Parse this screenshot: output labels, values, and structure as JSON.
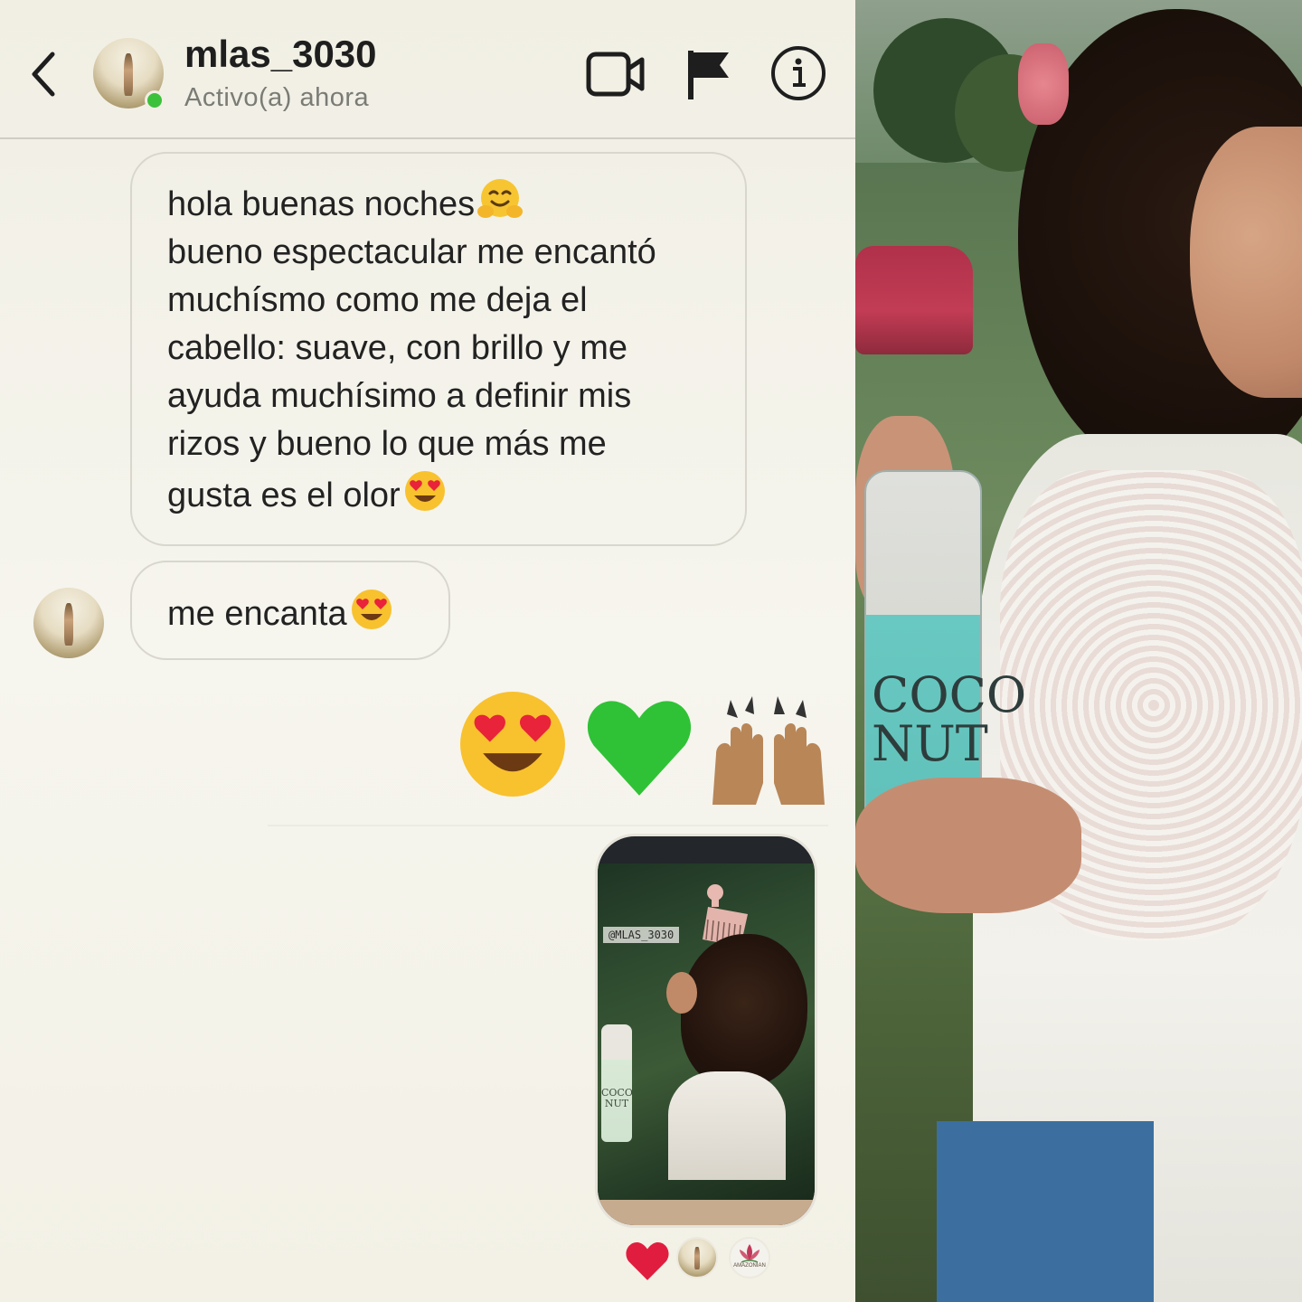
{
  "header": {
    "username": "mlas_3030",
    "status": "Activo(a) ahora",
    "icons": [
      "back-chevron-icon",
      "video-call-icon",
      "flag-icon",
      "info-icon"
    ]
  },
  "messages": [
    {
      "lines": [
        "hola buenas noches",
        "bueno espectacular me encantó",
        "muchísmo como me deja el",
        "cabello: suave, con brillo y me",
        "ayuda muchísimo a definir mis",
        "rizos y bueno lo que más me",
        "gusta es el olor"
      ],
      "emojis": [
        "hugging-face",
        "heart-eyes"
      ]
    },
    {
      "text": "me encanta",
      "emoji": "heart-eyes"
    }
  ],
  "sent_emojis": [
    "heart-eyes",
    "green-heart",
    "raised-hands"
  ],
  "story": {
    "tag": "@MLAS_3030",
    "bottle_label": "COCO NUT"
  },
  "reactions": [
    "red-heart",
    "avatar-mlas",
    "avatar-brand"
  ],
  "reaction_brand_label": "AMAZONIAN",
  "photo": {
    "bottle_label": "COCO NUT"
  },
  "colors": {
    "online": "#3cc13b",
    "bubble_border": "#d8d6cd",
    "text": "#222222",
    "status_text": "#7b7b76"
  }
}
